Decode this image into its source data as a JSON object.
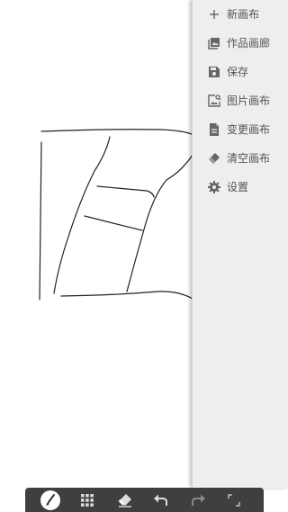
{
  "menu": {
    "items": [
      {
        "label": "新画布",
        "icon": "plus-icon"
      },
      {
        "label": "作品画廊",
        "icon": "gallery-icon"
      },
      {
        "label": "保存",
        "icon": "save-icon"
      },
      {
        "label": "图片画布",
        "icon": "image-search-icon"
      },
      {
        "label": "变更画布",
        "icon": "document-icon"
      },
      {
        "label": "清空画布",
        "icon": "eraser-icon"
      },
      {
        "label": "设置",
        "icon": "gear-icon"
      }
    ]
  },
  "toolbar": {
    "tools": [
      "brush-icon",
      "grid-icon",
      "eraser-icon",
      "undo-icon",
      "redo-icon",
      "resize-icon"
    ],
    "active_tool": "brush-icon"
  },
  "colors": {
    "menu_bg": "#eeeeee",
    "toolbar_bg": "#3f3f3f",
    "menu_icon": "#666666",
    "stroke": "#222222"
  }
}
